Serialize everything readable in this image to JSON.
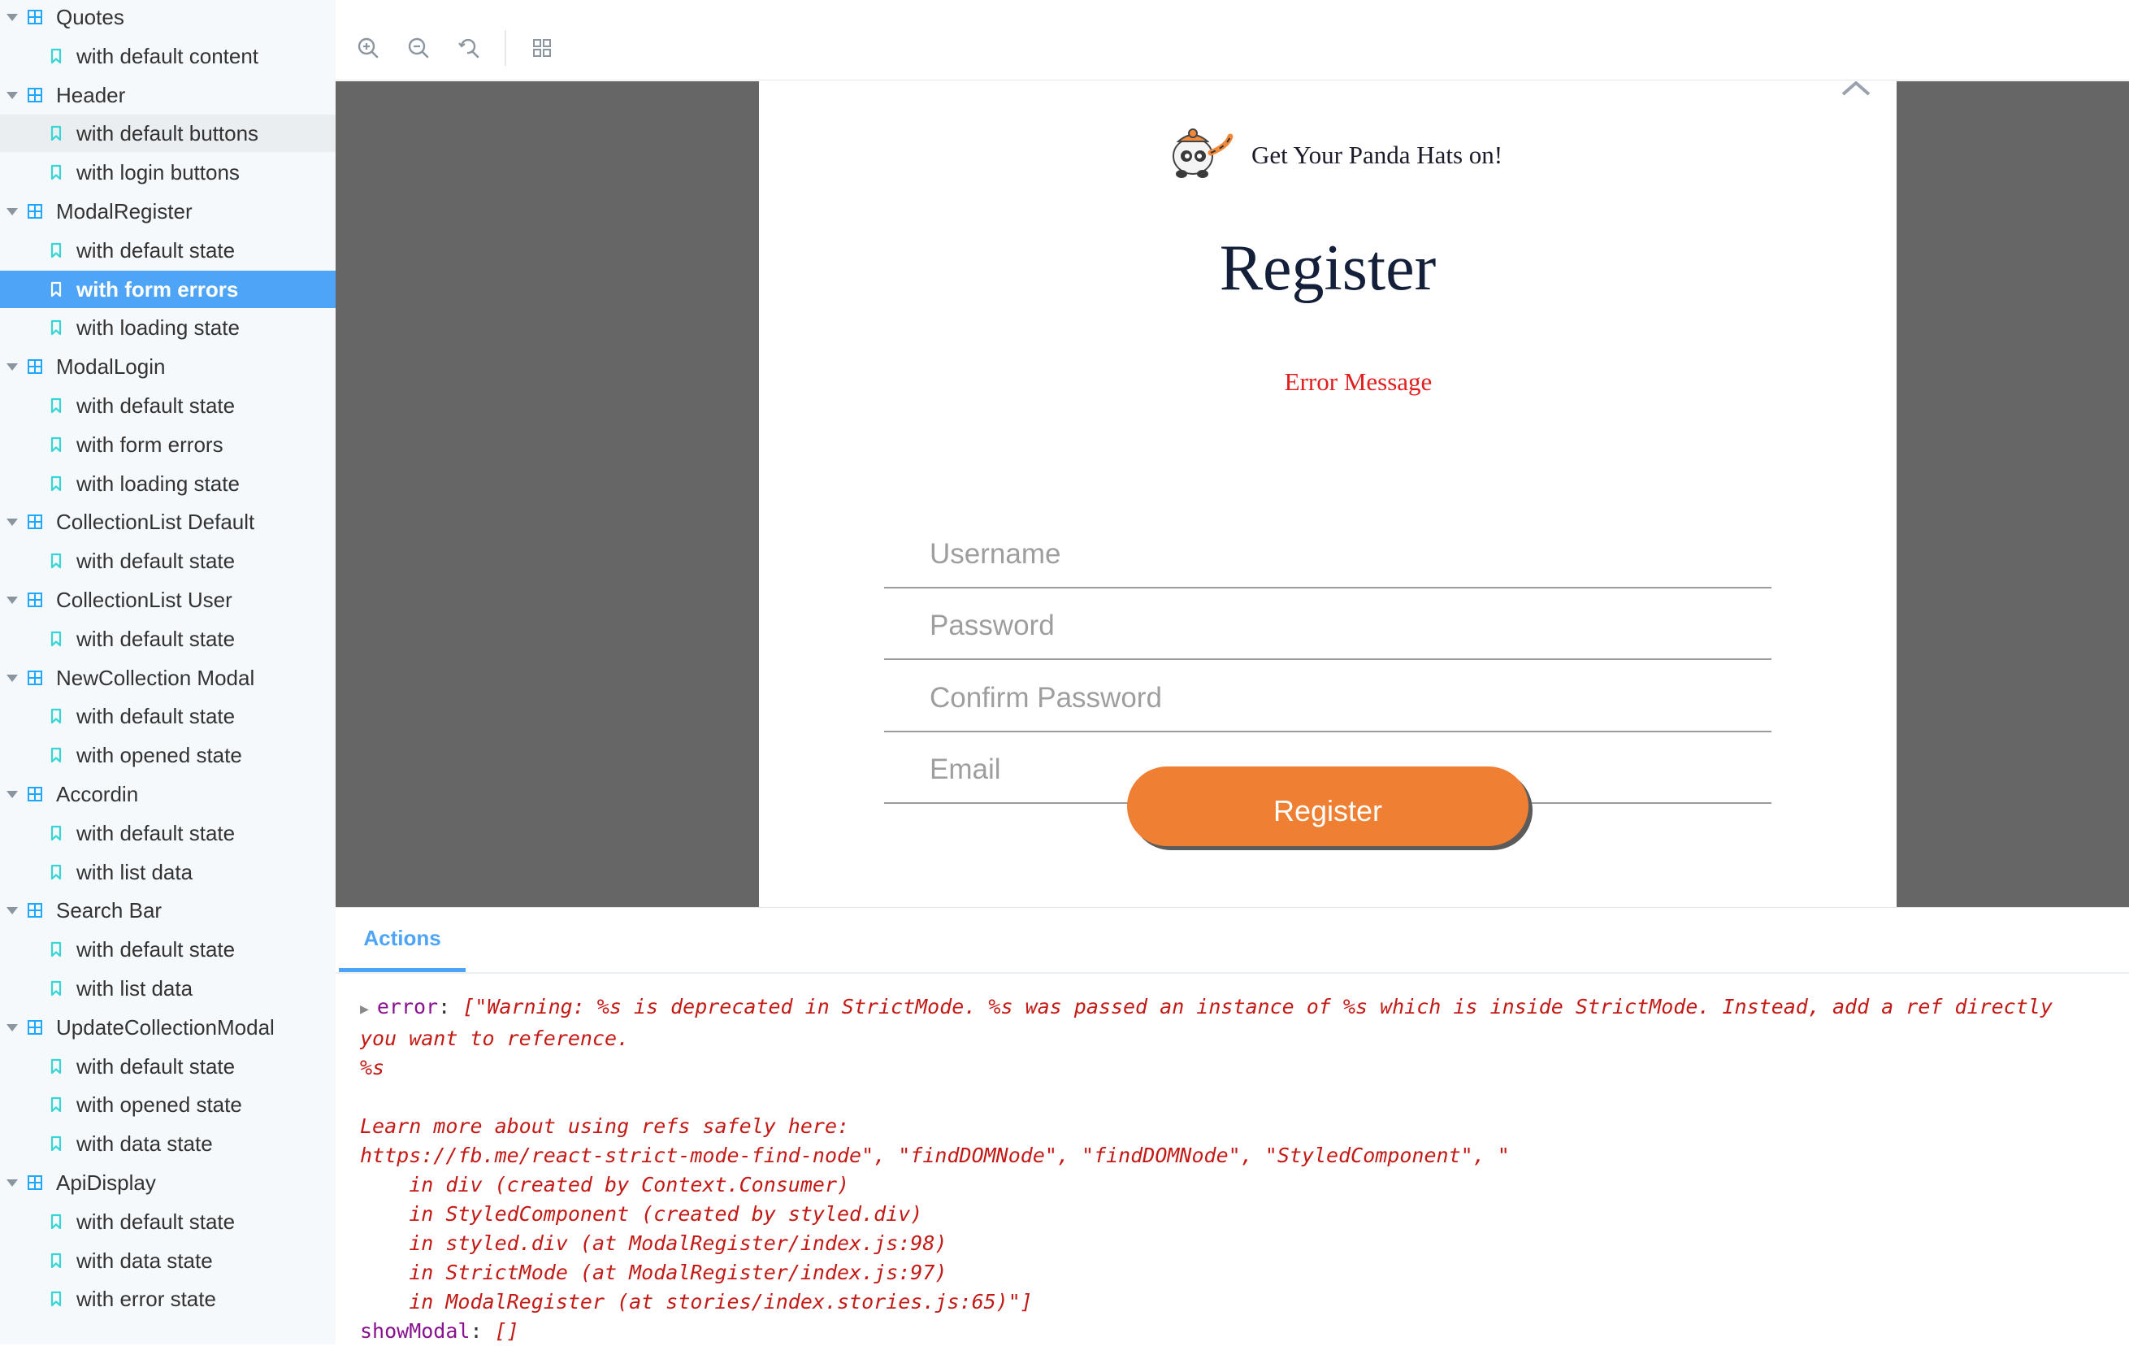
{
  "sidebar": {
    "items": [
      {
        "kind": "group",
        "label": "Quotes"
      },
      {
        "kind": "story",
        "label": "with default content"
      },
      {
        "kind": "group",
        "label": "Header"
      },
      {
        "kind": "story",
        "label": "with default buttons",
        "state": "hover"
      },
      {
        "kind": "story",
        "label": "with login buttons"
      },
      {
        "kind": "group",
        "label": "ModalRegister"
      },
      {
        "kind": "story",
        "label": "with default state"
      },
      {
        "kind": "story",
        "label": "with form errors",
        "state": "selected"
      },
      {
        "kind": "story",
        "label": "with loading state"
      },
      {
        "kind": "group",
        "label": "ModalLogin"
      },
      {
        "kind": "story",
        "label": "with default state"
      },
      {
        "kind": "story",
        "label": "with form errors"
      },
      {
        "kind": "story",
        "label": "with loading state"
      },
      {
        "kind": "group",
        "label": "CollectionList Default"
      },
      {
        "kind": "story",
        "label": "with default state"
      },
      {
        "kind": "group",
        "label": "CollectionList User"
      },
      {
        "kind": "story",
        "label": "with default state"
      },
      {
        "kind": "group",
        "label": "NewCollection Modal"
      },
      {
        "kind": "story",
        "label": "with default state"
      },
      {
        "kind": "story",
        "label": "with opened state"
      },
      {
        "kind": "group",
        "label": "Accordin"
      },
      {
        "kind": "story",
        "label": "with default state"
      },
      {
        "kind": "story",
        "label": "with list data"
      },
      {
        "kind": "group",
        "label": "Search Bar"
      },
      {
        "kind": "story",
        "label": "with default state"
      },
      {
        "kind": "story",
        "label": "with list data"
      },
      {
        "kind": "group",
        "label": "UpdateCollectionModal"
      },
      {
        "kind": "story",
        "label": "with default state"
      },
      {
        "kind": "story",
        "label": "with opened state"
      },
      {
        "kind": "story",
        "label": "with data state"
      },
      {
        "kind": "group",
        "label": "ApiDisplay"
      },
      {
        "kind": "story",
        "label": "with default state"
      },
      {
        "kind": "story",
        "label": "with data state"
      },
      {
        "kind": "story",
        "label": "with error state"
      }
    ]
  },
  "toolbar": {
    "icons": [
      "zoom-in-icon",
      "zoom-out-icon",
      "reset-zoom-icon",
      "grid-icon"
    ]
  },
  "modal": {
    "brand": "Get Your Panda Hats on!",
    "title": "Register",
    "error": "Error Message",
    "fields": {
      "username": "Username",
      "password": "Password",
      "confirm": "Confirm Password",
      "email": "Email"
    },
    "submit": "Register"
  },
  "addons": {
    "tab": "Actions",
    "log": {
      "key1": "error",
      "line1": "[\"Warning: %s is deprecated in StrictMode. %s was passed an instance of %s which is inside StrictMode. Instead, add a ref directly",
      "line2": "you want to reference.",
      "line3": "%s",
      "line4": "",
      "line5": "Learn more about using refs safely here:",
      "line6": "https://fb.me/react-strict-mode-find-node\", \"findDOMNode\", \"findDOMNode\", \"StyledComponent\", \"",
      "line7": "    in div (created by Context.Consumer)",
      "line8": "    in StyledComponent (created by styled.div)",
      "line9": "    in styled.div (at ModalRegister/index.js:98)",
      "line10": "    in StrictMode (at ModalRegister/index.js:97)",
      "line11": "    in ModalRegister (at stories/index.stories.js:65)\"]",
      "key2": "showModal",
      "val2": "[]"
    }
  },
  "colors": {
    "accent": "#4ea4f6",
    "button": "#ef7f33",
    "error": "#e01e1e",
    "teal_icon": "#37d5d3",
    "blue_icon": "#1ea7fd"
  }
}
